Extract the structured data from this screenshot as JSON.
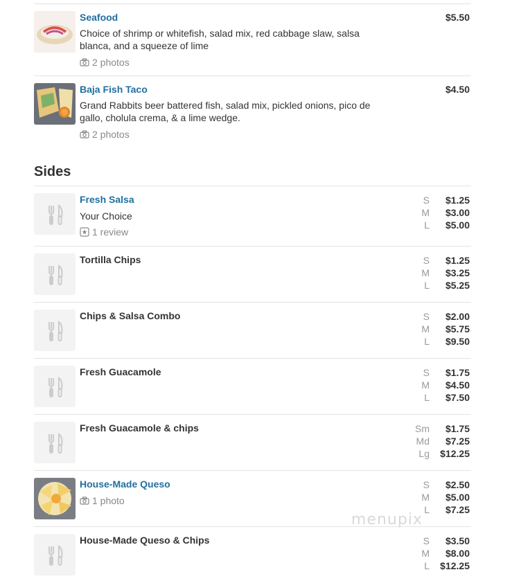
{
  "featured": [
    {
      "name": "Seafood",
      "desc": "Choice of shrimp or whitefish, salad mix, red cabbage slaw, salsa blanca, and a squeeze of lime",
      "meta": "2 photos",
      "price": "$5.50"
    },
    {
      "name": "Baja Fish Taco",
      "desc": "Grand Rabbits beer battered fish, salad mix, pickled onions, pico de gallo, cholula crema, & a lime wedge.",
      "meta": "2 photos",
      "price": "$4.50"
    }
  ],
  "section_title": "Sides",
  "sides": [
    {
      "name": "Fresh Salsa",
      "desc": "Your Choice",
      "meta": "1 review",
      "sizes": [
        {
          "label": "S",
          "price": "$1.25"
        },
        {
          "label": "M",
          "price": "$3.00"
        },
        {
          "label": "L",
          "price": "$5.00"
        }
      ]
    },
    {
      "name": "Tortilla Chips",
      "sizes": [
        {
          "label": "S",
          "price": "$1.25"
        },
        {
          "label": "M",
          "price": "$3.25"
        },
        {
          "label": "L",
          "price": "$5.25"
        }
      ]
    },
    {
      "name": "Chips & Salsa Combo",
      "sizes": [
        {
          "label": "S",
          "price": "$2.00"
        },
        {
          "label": "M",
          "price": "$5.75"
        },
        {
          "label": "L",
          "price": "$9.50"
        }
      ]
    },
    {
      "name": "Fresh Guacamole",
      "sizes": [
        {
          "label": "S",
          "price": "$1.75"
        },
        {
          "label": "M",
          "price": "$4.50"
        },
        {
          "label": "L",
          "price": "$7.50"
        }
      ]
    },
    {
      "name": "Fresh Guacamole & chips",
      "sizes": [
        {
          "label": "Sm",
          "price": "$1.75"
        },
        {
          "label": "Md",
          "price": "$7.25"
        },
        {
          "label": "Lg",
          "price": "$12.25"
        }
      ]
    },
    {
      "name": "House-Made Queso",
      "meta": "1 photo",
      "sizes": [
        {
          "label": "S",
          "price": "$2.50"
        },
        {
          "label": "M",
          "price": "$5.00"
        },
        {
          "label": "L",
          "price": "$7.25"
        }
      ]
    },
    {
      "name": "House-Made Queso & Chips",
      "sizes": [
        {
          "label": "S",
          "price": "$3.50"
        },
        {
          "label": "M",
          "price": "$8.00"
        },
        {
          "label": "L",
          "price": "$12.25"
        }
      ]
    }
  ],
  "watermark": "menupix",
  "colors": {
    "link": "#1f6f9f",
    "text": "#333333",
    "muted": "#888888",
    "divider": "#e3e3e3"
  }
}
